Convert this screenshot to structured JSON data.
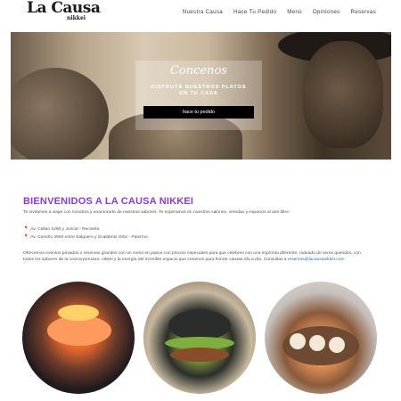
{
  "header": {
    "logo_text": "La Causa",
    "logo_sub": "nikkei",
    "nav": [
      "Nuestra Causa",
      "Hace Tu Pedido",
      "Menú",
      "Opiniones",
      "Reservas"
    ]
  },
  "hero": {
    "script_title": "Concenos",
    "tagline_line1": "DISFRUTÁ NUESTROS PLATOS",
    "tagline_line2": "EN TU CASA",
    "cta_label": "hace tu pedido"
  },
  "main": {
    "heading": "BIENVENIDOS A LA CAUSA NIKKEI",
    "intro": "Te invitamos a viajar con nosotros y enamorarte de nuestros sabores. Te esperamos en nuestros salones, veredas y espacios al aire libre.",
    "address1": "Av. Callao 1290 y Juncal - Recoleta",
    "address2": "Av. Corviño 3550 entre Salguero y Scalabrini Ortiz - Palermo",
    "paragraph": "Ofrecemos eventos privados o reservas grandes con un menú en pasos con precios especiales para que celebres con una impronta diferente, rodeado de seres queridos, con todos los sabores de la cocina peruana- nikkei y la energía del increíble espacio que creamos para honrar causas día a día. Consultas a",
    "email": "reservas@lacausanikkei.com"
  },
  "icons": {
    "pin": "location-pin-icon"
  },
  "colors": {
    "accent": "#8a3bd6",
    "link": "#2b6cb0",
    "cta_bg": "#000000"
  }
}
